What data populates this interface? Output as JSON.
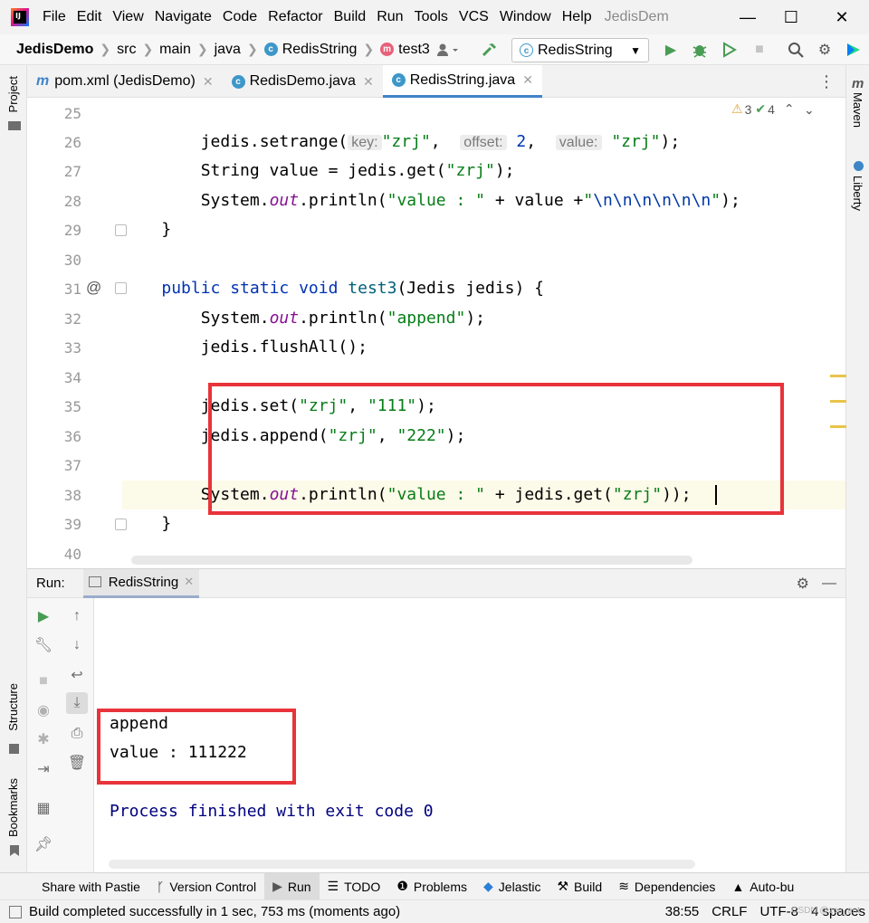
{
  "titlebar": {
    "logo": "IJ",
    "menu": [
      "File",
      "Edit",
      "View",
      "Navigate",
      "Code",
      "Refactor",
      "Build",
      "Run",
      "Tools",
      "VCS",
      "Window",
      "Help"
    ],
    "title": "JedisDem",
    "minimize": "—",
    "maximize": "☐",
    "close": "✕"
  },
  "breadcrumb": {
    "project": "JedisDemo",
    "src": "src",
    "main": "main",
    "java": "java",
    "class": "RedisString",
    "method": "test3"
  },
  "run_config": "RedisString",
  "tabs": [
    {
      "label": "pom.xml (JedisDemo)",
      "icon": "m"
    },
    {
      "label": "RedisDemo.java",
      "icon": "c"
    },
    {
      "label": "RedisString.java",
      "icon": "c"
    }
  ],
  "left_strip": {
    "project": "Project",
    "structure": "Structure",
    "bookmarks": "Bookmarks"
  },
  "right_strip": {
    "maven": "Maven",
    "liberty": "Liberty"
  },
  "editor_status": {
    "warnings": "3",
    "checks": "4"
  },
  "line_numbers": [
    "25",
    "26",
    "27",
    "28",
    "29",
    "30",
    "31",
    "32",
    "33",
    "34",
    "35",
    "36",
    "37",
    "38",
    "39",
    "40"
  ],
  "code": {
    "l26": {
      "a": "        jedis.setrange(",
      "h1": "key:",
      "s1": "\"zrj\"",
      "c1": ",  ",
      "h2": "offset:",
      "n": " 2",
      "c2": ",  ",
      "h3": "value:",
      "s2": " \"zrj\"",
      "e": ");"
    },
    "l27": {
      "a": "        String value = jedis.get(",
      "s": "\"zrj\"",
      "e": ");"
    },
    "l28": {
      "a": "        System.",
      "f": "out",
      "b": ".println(",
      "s": "\"value : \"",
      "c": " + value +",
      "s2": "\"",
      "esc": "\\n\\n\\n\\n\\n\\n",
      "s3": "\"",
      "e": ");"
    },
    "l29": "    }",
    "l31": {
      "a": "    ",
      "kw": "public static void ",
      "fn": "test3",
      "b": "(Jedis jedis) {"
    },
    "l32": {
      "a": "        System.",
      "f": "out",
      "b": ".println(",
      "s": "\"append\"",
      "e": ");"
    },
    "l33": "        jedis.flushAll();",
    "l35": {
      "a": "        jedis.set(",
      "s1": "\"zrj\"",
      "c": ", ",
      "s2": "\"111\"",
      "e": ");"
    },
    "l36": {
      "a": "        jedis.append(",
      "s1": "\"zrj\"",
      "c": ", ",
      "s2": "\"222\"",
      "e": ");"
    },
    "l38": {
      "a": "        System.",
      "f": "out",
      "b": ".println(",
      "s": "\"value : \"",
      "c": " + jedis.get(",
      "s2": "\"zrj\"",
      "e": "));"
    },
    "l39": "    }"
  },
  "run": {
    "label": "Run:",
    "tab": "RedisString"
  },
  "console": {
    "line1": "append",
    "line2": "value : 111222",
    "line3": "Process finished with exit code 0"
  },
  "toolwindows": [
    "Share with Pastie",
    "Version Control",
    "Run",
    "TODO",
    "Problems",
    "Jelastic",
    "Build",
    "Dependencies",
    "Auto-bu"
  ],
  "status": {
    "message": "Build completed successfully in 1 sec, 753 ms (moments ago)",
    "position": "38:55",
    "line_sep": "CRLF",
    "encoding": "UTF-8",
    "indent": "4 spaces",
    "watermark": "CSDN @zcs_ant"
  },
  "colors": {
    "highlight_border": "#e8333a",
    "keyword": "#0033b3",
    "string": "#067d17",
    "field": "#871094",
    "console_blue": "#000080"
  }
}
